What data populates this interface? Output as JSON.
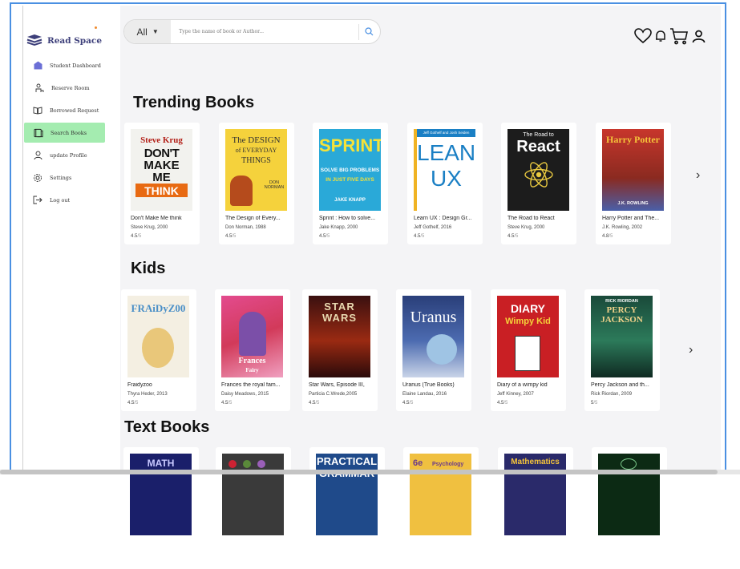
{
  "brand": {
    "name": "Read Space"
  },
  "sidebar": {
    "items": [
      {
        "label": "Student Dashboard",
        "icon": "dashboard-icon"
      },
      {
        "label": "Reserve Room",
        "icon": "room-icon"
      },
      {
        "label": "Borrowed Request",
        "icon": "book-open-icon"
      },
      {
        "label": "Search Books",
        "icon": "books-icon",
        "active": true
      },
      {
        "label": "update Profile",
        "icon": "user-icon"
      },
      {
        "label": "Settings",
        "icon": "gear-icon"
      },
      {
        "label": "Log out",
        "icon": "logout-icon"
      }
    ]
  },
  "search": {
    "category": "All",
    "placeholder": "Type the name of book or Author..."
  },
  "sections": {
    "trending": {
      "title": "Trending Books",
      "books": [
        {
          "title": "Don't Make Me think",
          "author": "Steve Krug, 2000",
          "rating": "4.5",
          "max": "/5",
          "cover_text": [
            "Steve Krug",
            "DON'T",
            "MAKE",
            "ME",
            "THINK"
          ]
        },
        {
          "title": "The Design of Every...",
          "author": "Don Norman, 1988",
          "rating": "4.5",
          "max": "/5",
          "cover_text": [
            "The DESIGN",
            "of EVERYDAY",
            "THINGS",
            "DON NORMAN"
          ]
        },
        {
          "title": "Sprint : How to solve...",
          "author": "Jake Knapp, 2000",
          "rating": "4.5",
          "max": "/5",
          "cover_text": [
            "SPRINT",
            "SOLVE BIG PROBLEMS",
            "IN JUST FIVE DAYS",
            "JAKE KNAPP"
          ]
        },
        {
          "title": "Learn UX : Design Gr...",
          "author": "Jeff Gothelf, 2016",
          "rating": "4.5",
          "max": "/5",
          "cover_text": [
            "Jeff Gothelf and Josh Seiden",
            "LEAN",
            "UX"
          ]
        },
        {
          "title": "The Road to React",
          "author": "Steve Krug, 2000",
          "rating": "4.5",
          "max": "/5",
          "cover_text": [
            "The Road to",
            "React"
          ]
        },
        {
          "title": "Harry Potter and The...",
          "author": "J.K. Rowling, 2002",
          "rating": "4.8",
          "max": "/5",
          "cover_text": [
            "Harry Potter",
            "J.K. ROWLING"
          ]
        }
      ]
    },
    "kids": {
      "title": "Kids",
      "books": [
        {
          "title": "Fraidyzoo",
          "author": "Thyra Heder, 2013",
          "rating": "4.5",
          "max": "/5",
          "cover_text": [
            "FRAiDyZ00"
          ]
        },
        {
          "title": "Frances the royal fam...",
          "author": "Daisy Meadows, 2015",
          "rating": "4.5",
          "max": "/5",
          "cover_text": [
            "Frances",
            "Fairy"
          ]
        },
        {
          "title": "Star Wars, Episode III,",
          "author": "Particia C.Wrede,2005",
          "rating": "4.5",
          "max": "/5",
          "cover_text": [
            "STAR",
            "WARS"
          ]
        },
        {
          "title": "Uranus (True Books)",
          "author": "Elaine Landau, 2016",
          "rating": "4.5",
          "max": "/5",
          "cover_text": [
            "Uranus"
          ]
        },
        {
          "title": "Diary of a wimpy kid",
          "author": "Jeff Kinney, 2007",
          "rating": "4.5",
          "max": "/5",
          "cover_text": [
            "DIARY",
            "Wimpy Kid"
          ]
        },
        {
          "title": "Percy Jackson and th...",
          "author": "Rick Riordan, 2009",
          "rating": "5",
          "max": "/5",
          "cover_text": [
            "RICK RIORDAN",
            "PERCY",
            "JACKSON"
          ]
        }
      ]
    },
    "textbooks": {
      "title": "Text Books",
      "books": [
        {
          "cover_text": [
            "MATH"
          ]
        },
        {
          "cover_text": [
            ""
          ]
        },
        {
          "cover_text": [
            "PRACTICAL",
            "GRAMMAR"
          ]
        },
        {
          "cover_text": [
            "6e",
            "Psychology"
          ]
        },
        {
          "cover_text": [
            "Mathematics"
          ]
        },
        {
          "cover_text": [
            ""
          ]
        }
      ]
    }
  },
  "colors": {
    "accent_active": "#a4ecb0",
    "brand": "#3d3f7a",
    "frame": "#4a90e2"
  }
}
